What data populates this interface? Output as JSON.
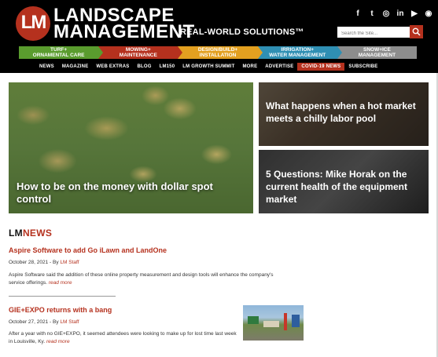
{
  "header": {
    "logo_mark": "LM",
    "brand_line_1": "LANDSCAPE",
    "brand_line_2": "MANAGEMENT",
    "tagline": "REAL-WORLD SOLUTIONS™",
    "search_placeholder": "Search the Site...",
    "social": [
      {
        "icon": "facebook-icon",
        "glyph": "f"
      },
      {
        "icon": "twitter-icon",
        "glyph": "t"
      },
      {
        "icon": "instagram-icon",
        "glyph": "◎"
      },
      {
        "icon": "linkedin-icon",
        "glyph": "in"
      },
      {
        "icon": "youtube-icon",
        "glyph": "▶"
      },
      {
        "icon": "rss-icon",
        "glyph": "◉"
      }
    ]
  },
  "categories": [
    {
      "line1": "TURF+",
      "line2": "ORNAMENTAL CARE",
      "color": "#5a9c2e"
    },
    {
      "line1": "MOWING+",
      "line2": "MAINTENANCE",
      "color": "#b5311e"
    },
    {
      "line1": "DESIGN/BUILD+",
      "line2": "INSTALLATION",
      "color": "#e3a020"
    },
    {
      "line1": "IRRIGATION+",
      "line2": "WATER MANAGEMENT",
      "color": "#2f8fb3"
    },
    {
      "line1": "SNOW+ICE",
      "line2": "MANAGEMENT",
      "color": "#8d8d8d"
    }
  ],
  "nav": [
    "NEWS",
    "MAGAZINE",
    "WEB EXTRAS",
    "BLOG",
    "LM150",
    "LM GROWTH SUMMIT",
    "MORE",
    "ADVERTISE",
    "COVID-19 NEWS",
    "SUBSCRIBE"
  ],
  "hero": {
    "main_title": "How to be on the money with dollar spot control",
    "side_1_title": "What happens when a hot market meets a chilly labor pool",
    "side_2_title": "5 Questions: Mike Horak on the current health of the equipment market"
  },
  "news": {
    "heading_lm": "LM",
    "heading_news": "NEWS",
    "items": [
      {
        "title": "Aspire Software to add Go iLawn and LandOne",
        "date": "October 28, 2021",
        "by": "By",
        "author": "LM Staff",
        "body": "Aspire Software said the addition of these online property measurement and design tools will enhance the company's service offerings.",
        "more": "read more"
      },
      {
        "title": "GIE+EXPO returns with a bang",
        "date": "October 27, 2021",
        "by": "By",
        "author": "LM Staff",
        "body": "After a year with no GIE+EXPO, it seemed attendees were looking to make up for lost time last week in Louisville, Ky.",
        "more": "read more"
      }
    ]
  },
  "colors": {
    "brand_red": "#b5311e",
    "header_bg": "#000000"
  }
}
